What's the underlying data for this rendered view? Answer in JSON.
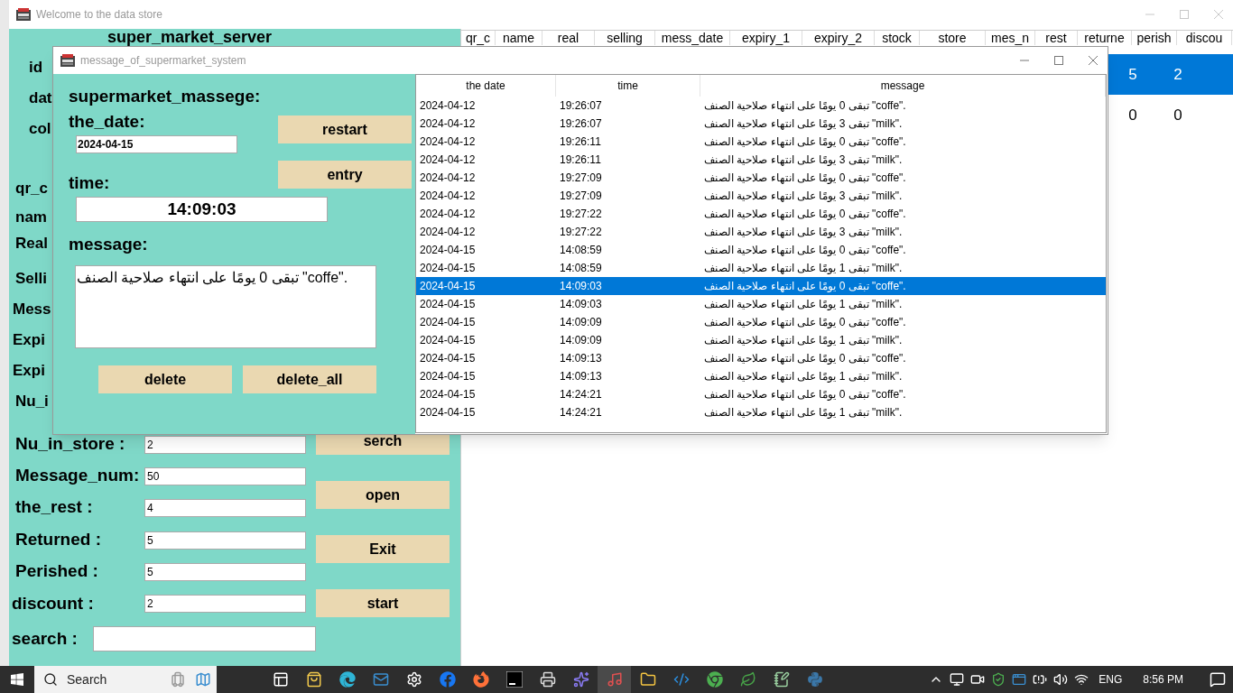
{
  "main_window": {
    "title": "Welcome to the data store",
    "heading": "super_market_server",
    "hidden_labels": [
      "id",
      "dat",
      "col",
      "qr_c",
      "nam",
      "Real",
      "Selli",
      "Mess",
      "Expi",
      "Expi",
      "Nu_i"
    ],
    "fields": [
      {
        "label": "Nu_in_store :",
        "value": "2"
      },
      {
        "label": "Message_num:",
        "value": "50"
      },
      {
        "label": "the_rest :",
        "value": "4"
      },
      {
        "label": "Returned :",
        "value": "5"
      },
      {
        "label": "Perished :",
        "value": "5"
      },
      {
        "label": "discount :",
        "value": "2"
      }
    ],
    "search": {
      "label": "search :"
    },
    "buttons": [
      "serch",
      "open",
      "Exit",
      "start"
    ],
    "table": {
      "columns": [
        "qr_c",
        "name",
        "real",
        "selling",
        "mess_date",
        "expiry_1",
        "expiry_2",
        "stock",
        "store",
        "mes_n",
        "rest",
        "returne",
        "perish",
        "discou"
      ],
      "rows": [
        {
          "selected": true,
          "perish": "5",
          "discou": "2"
        },
        {
          "selected": false,
          "perish": "0",
          "discou": "0"
        }
      ]
    }
  },
  "dialog": {
    "title": "message_of_supermarket_system",
    "heading": "supermarket_massege:",
    "date_label": "the_date:",
    "date_value": "2024-04-15",
    "time_label": "time:",
    "time_value": "14:09:03",
    "message_label": "message:",
    "message_value": "تبقى 0 يومًا على انتهاء صلاحية الصنف \"coffe\".",
    "top_buttons": [
      "restart",
      "entry"
    ],
    "bottom_buttons": [
      "delete",
      "delete_all"
    ],
    "list": {
      "columns": [
        "the date",
        "time",
        "message"
      ],
      "rows": [
        {
          "date": "2024-04-12",
          "time": "19:26:07",
          "message": "تبقى 0 يومًا على انتهاء صلاحية الصنف \"coffe\".",
          "selected": false
        },
        {
          "date": "2024-04-12",
          "time": "19:26:07",
          "message": "تبقى 3 يومًا على انتهاء صلاحية الصنف \"milk\".",
          "selected": false
        },
        {
          "date": "2024-04-12",
          "time": "19:26:11",
          "message": "تبقى 0 يومًا على انتهاء صلاحية الصنف \"coffe\".",
          "selected": false
        },
        {
          "date": "2024-04-12",
          "time": "19:26:11",
          "message": "تبقى 3 يومًا على انتهاء صلاحية الصنف \"milk\".",
          "selected": false
        },
        {
          "date": "2024-04-12",
          "time": "19:27:09",
          "message": "تبقى 0 يومًا على انتهاء صلاحية الصنف \"coffe\".",
          "selected": false
        },
        {
          "date": "2024-04-12",
          "time": "19:27:09",
          "message": "تبقى 3 يومًا على انتهاء صلاحية الصنف \"milk\".",
          "selected": false
        },
        {
          "date": "2024-04-12",
          "time": "19:27:22",
          "message": "تبقى 0 يومًا على انتهاء صلاحية الصنف \"coffe\".",
          "selected": false
        },
        {
          "date": "2024-04-12",
          "time": "19:27:22",
          "message": "تبقى 3 يومًا على انتهاء صلاحية الصنف \"milk\".",
          "selected": false
        },
        {
          "date": "2024-04-15",
          "time": "14:08:59",
          "message": "تبقى 0 يومًا على انتهاء صلاحية الصنف \"coffe\".",
          "selected": false
        },
        {
          "date": "2024-04-15",
          "time": "14:08:59",
          "message": "تبقى 1 يومًا على انتهاء صلاحية الصنف \"milk\".",
          "selected": false
        },
        {
          "date": "2024-04-15",
          "time": "14:09:03",
          "message": "تبقى 0 يومًا على انتهاء صلاحية الصنف \"coffe\".",
          "selected": true
        },
        {
          "date": "2024-04-15",
          "time": "14:09:03",
          "message": "تبقى 1 يومًا على انتهاء صلاحية الصنف \"milk\".",
          "selected": false
        },
        {
          "date": "2024-04-15",
          "time": "14:09:09",
          "message": "تبقى 0 يومًا على انتهاء صلاحية الصنف \"coffe\".",
          "selected": false
        },
        {
          "date": "2024-04-15",
          "time": "14:09:09",
          "message": "تبقى 1 يومًا على انتهاء صلاحية الصنف \"milk\".",
          "selected": false
        },
        {
          "date": "2024-04-15",
          "time": "14:09:13",
          "message": "تبقى 0 يومًا على انتهاء صلاحية الصنف \"coffe\".",
          "selected": false
        },
        {
          "date": "2024-04-15",
          "time": "14:09:13",
          "message": "تبقى 1 يومًا على انتهاء صلاحية الصنف \"milk\".",
          "selected": false
        },
        {
          "date": "2024-04-15",
          "time": "14:24:21",
          "message": "تبقى 0 يومًا على انتهاء صلاحية الصنف \"coffe\".",
          "selected": false
        },
        {
          "date": "2024-04-15",
          "time": "14:24:21",
          "message": "تبقى 1 يومًا على انتهاء صلاحية الصنف \"milk\".",
          "selected": false
        }
      ]
    }
  },
  "taskbar": {
    "search_placeholder": "Search",
    "language": "ENG",
    "clock": "8:56 PM"
  }
}
